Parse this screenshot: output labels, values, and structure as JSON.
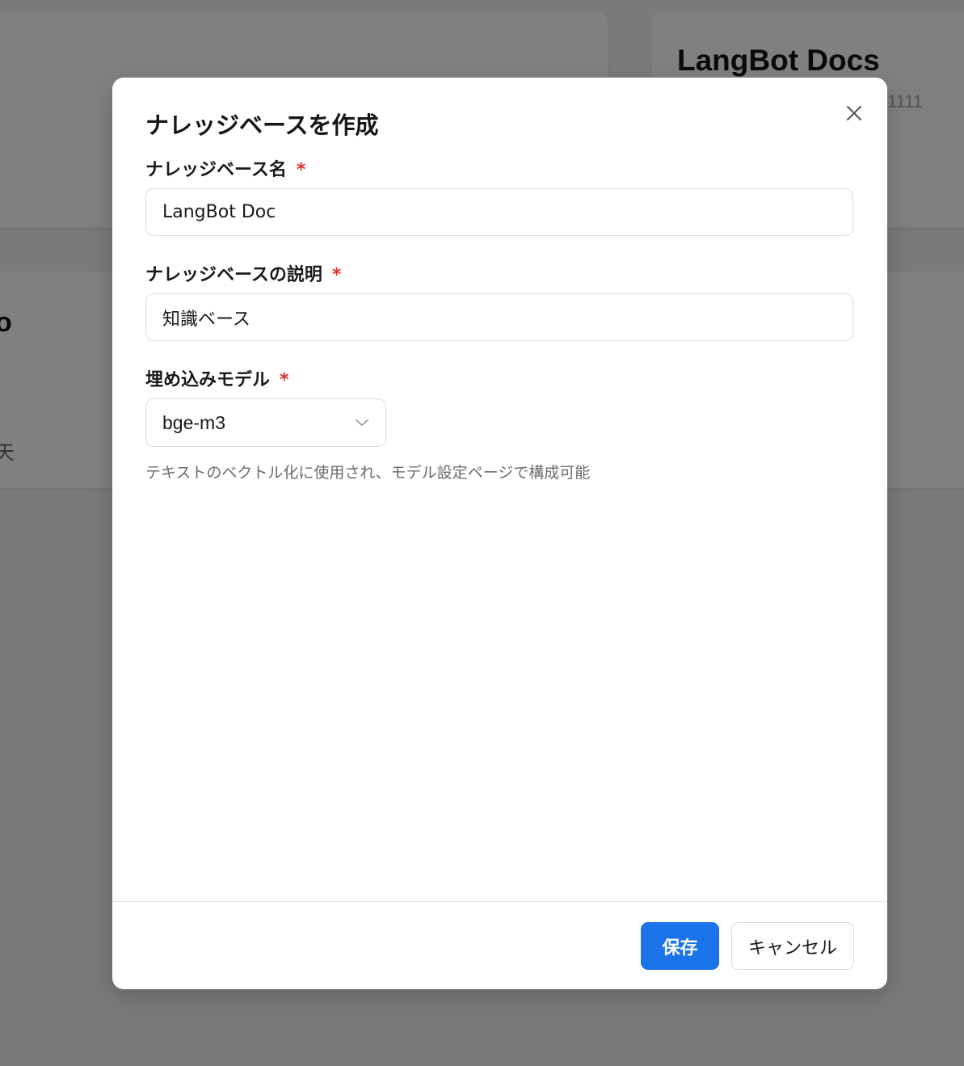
{
  "background": {
    "card_title": "LangBot Docs",
    "card_subtext": "1111",
    "fragment_1": "o",
    "fragment_2": "天"
  },
  "dialog": {
    "title": "ナレッジベースを作成",
    "close_icon": "close-icon",
    "fields": {
      "name": {
        "label": "ナレッジベース名",
        "required_mark": "*",
        "value": "LangBot Doc"
      },
      "description": {
        "label": "ナレッジベースの説明",
        "required_mark": "*",
        "value": "知識ベース"
      },
      "embedding_model": {
        "label": "埋め込みモデル",
        "required_mark": "*",
        "selected": "bge-m3",
        "helper": "テキストのベクトル化に使用され、モデル設定ページで構成可能"
      }
    },
    "footer": {
      "save_label": "保存",
      "cancel_label": "キャンセル"
    }
  },
  "colors": {
    "accent": "#1a73e8",
    "required": "#e0312f",
    "overlay": "#7a7a7a"
  }
}
